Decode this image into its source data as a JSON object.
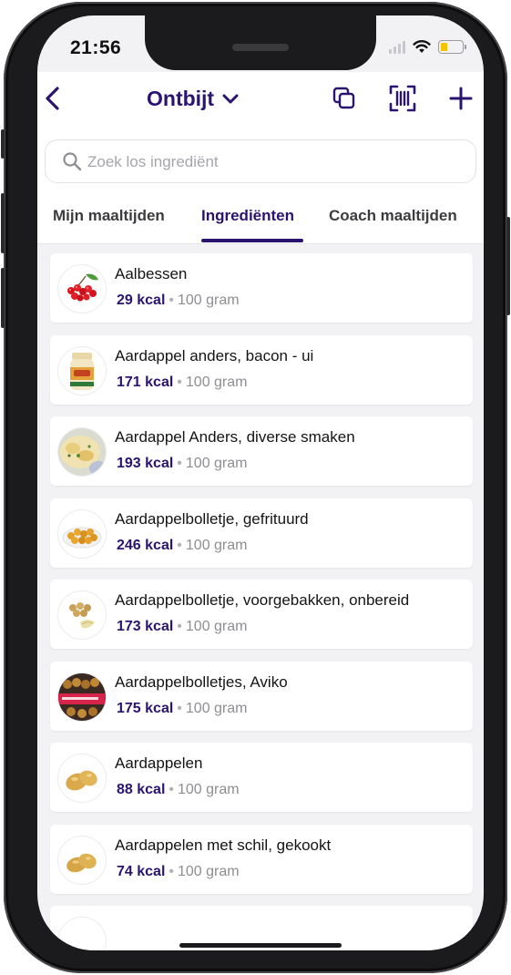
{
  "status_bar": {
    "time": "21:56"
  },
  "header": {
    "title": "Ontbijt"
  },
  "search": {
    "placeholder": "Zoek los ingrediënt"
  },
  "tabs": [
    {
      "label": "Mijn maaltijden"
    },
    {
      "label": "Ingrediënten"
    },
    {
      "label": "Coach maaltijden"
    }
  ],
  "active_tab": "Ingrediënten",
  "items": [
    {
      "name": "Aalbessen",
      "kcal": "29 kcal",
      "amount": "100 gram",
      "image": "redcurrant"
    },
    {
      "name": "Aardappel anders, bacon - ui",
      "kcal": "171 kcal",
      "amount": "100 gram",
      "image": "jar"
    },
    {
      "name": "Aardappel Anders, diverse smaken",
      "kcal": "193 kcal",
      "amount": "100 gram",
      "image": "gratin"
    },
    {
      "name": "Aardappelbolletje, gefrituurd",
      "kcal": "246 kcal",
      "amount": "100 gram",
      "image": "fried-balls"
    },
    {
      "name": "Aardappelbolletje, voorgebakken, onbereid",
      "kcal": "173 kcal",
      "amount": "100 gram",
      "image": "raw-balls"
    },
    {
      "name": "Aardappelbolletjes, Aviko",
      "kcal": "175 kcal",
      "amount": "100 gram",
      "image": "aviko-bag"
    },
    {
      "name": "Aardappelen",
      "kcal": "88 kcal",
      "amount": "100 gram",
      "image": "potatoes"
    },
    {
      "name": "Aardappelen met schil, gekookt",
      "kcal": "74 kcal",
      "amount": "100 gram",
      "image": "boiled-potatoes"
    }
  ],
  "colors": {
    "primary": "#2a1470",
    "accent_battery": "#f5c400"
  }
}
